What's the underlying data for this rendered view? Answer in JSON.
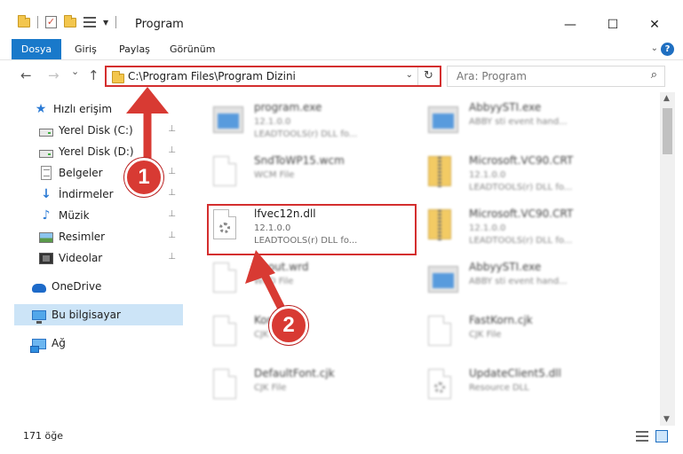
{
  "window": {
    "title": "Program",
    "minimize_glyph": "—",
    "maximize_glyph": "☐",
    "close_glyph": "✕"
  },
  "ribbon": {
    "tabs": [
      "Dosya",
      "Giriş",
      "Paylaş",
      "Görünüm"
    ],
    "expand_glyph": "⌄",
    "help_glyph": "?"
  },
  "nav": {
    "back_glyph": "←",
    "forward_glyph": "→",
    "recent_glyph": "⌄",
    "up_glyph": "↑",
    "address": "C:\\Program Files\\Program Dizini",
    "address_dropdown_glyph": "⌄",
    "refresh_glyph": "↻",
    "search_placeholder": "Ara: Program",
    "search_glyph": "⌕"
  },
  "sidebar": {
    "pin_glyph": "📌",
    "items": [
      {
        "label": "Hızlı erişim",
        "icon": "star-icon",
        "pinned": false
      },
      {
        "label": "Yerel Disk (C:)",
        "icon": "drive-icon",
        "pinned": true
      },
      {
        "label": "Yerel Disk (D:)",
        "icon": "drive-icon",
        "pinned": true
      },
      {
        "label": "Belgeler",
        "icon": "documents-icon",
        "pinned": true
      },
      {
        "label": "İndirmeler",
        "icon": "download-icon",
        "pinned": true
      },
      {
        "label": "Müzik",
        "icon": "music-icon",
        "pinned": true
      },
      {
        "label": "Resimler",
        "icon": "pictures-icon",
        "pinned": true
      },
      {
        "label": "Videolar",
        "icon": "videos-icon",
        "pinned": true
      },
      {
        "label": "OneDrive",
        "icon": "onedrive-icon",
        "pinned": false
      },
      {
        "label": "Bu bilgisayar",
        "icon": "this-pc-icon",
        "pinned": false,
        "selected": true
      },
      {
        "label": "Ağ",
        "icon": "network-icon",
        "pinned": false
      }
    ]
  },
  "files": [
    {
      "name": "program.exe",
      "line2": "12.1.0.0",
      "line3": "LEADTOOLS(r) DLL fo...",
      "type": "exe",
      "blurred": true
    },
    {
      "name": "AbbyySTI.exe",
      "line2": "ABBY sti event hand...",
      "line3": "",
      "type": "exe",
      "blurred": true
    },
    {
      "name": "SndToWP15.wcm",
      "line2": "WCM File",
      "line3": "",
      "type": "doc",
      "blurred": true
    },
    {
      "name": "Microsoft.VC90.CRT",
      "line2": "12.1.0.0",
      "line3": "LEADTOOLS(r) DLL fo...",
      "type": "zip",
      "blurred": true
    },
    {
      "name": "lfvec12n.dll",
      "line2": "12.1.0.0",
      "line3": "LEADTOOLS(r) DLL fo...",
      "type": "dll",
      "blurred": false
    },
    {
      "name": "Microsoft.VC90.CRT",
      "line2": "12.1.0.0",
      "line3": "LEADTOOLS(r) DLL fo...",
      "type": "zip",
      "blurred": true
    },
    {
      "name": "About.wrd",
      "line2": "WRD File",
      "line3": "",
      "type": "doc",
      "blurred": true
    },
    {
      "name": "AbbyySTI.exe",
      "line2": "ABBY sti event hand...",
      "line3": "",
      "type": "exe",
      "blurred": true
    },
    {
      "name": "Kore.cjk",
      "line2": "CJK File",
      "line3": "",
      "type": "doc",
      "blurred": true
    },
    {
      "name": "FastKorn.cjk",
      "line2": "CJK File",
      "line3": "",
      "type": "doc",
      "blurred": true
    },
    {
      "name": "DefaultFont.cjk",
      "line2": "CJK File",
      "line3": "",
      "type": "doc",
      "blurred": true
    },
    {
      "name": "UpdateClient5.dll",
      "line2": "Resource DLL",
      "line3": "",
      "type": "dll",
      "blurred": true
    }
  ],
  "status": {
    "count": "171 öğe"
  },
  "callouts": [
    "1",
    "2"
  ],
  "colors": {
    "accent": "#1979ca",
    "highlight": "#d42e2e",
    "callout": "#d83a33",
    "selected": "#cce4f7"
  }
}
